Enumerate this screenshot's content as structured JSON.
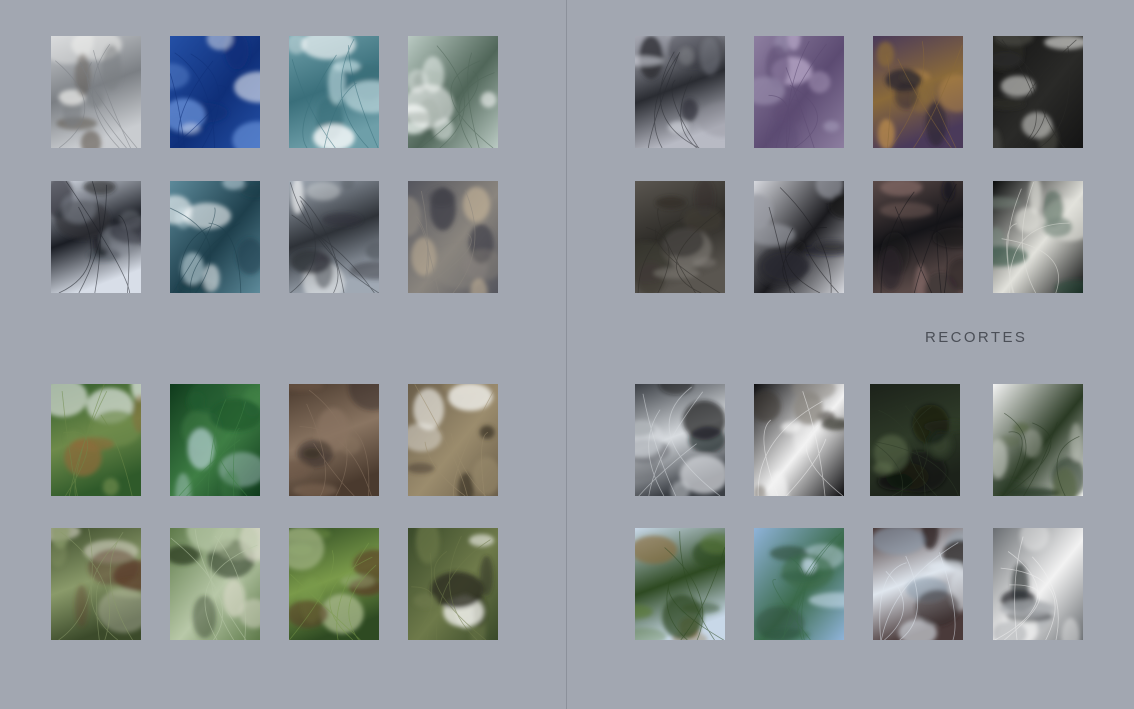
{
  "page": {
    "section_label": "RECORTES"
  },
  "photos": {
    "left": [
      {
        "subject": "steam-over-field",
        "colors": [
          "#c9ccd0",
          "#7b7f84",
          "#f2f2f0",
          "#5e564d"
        ]
      },
      {
        "subject": "deep-blue-water",
        "colors": [
          "#2450a6",
          "#0f2f79",
          "#6b95dc",
          "#ffffff"
        ]
      },
      {
        "subject": "turquoise-waves",
        "colors": [
          "#6e9fa9",
          "#3a6f7b",
          "#bcd7dc",
          "#ffffff"
        ]
      },
      {
        "subject": "wave-splash",
        "colors": [
          "#b9c9c2",
          "#506659",
          "#e9f0ec",
          "#ffffff"
        ]
      },
      {
        "subject": "bare-branches",
        "colors": [
          "#d8dee8",
          "#1a1d24",
          "#8a8f99",
          "#2f3138"
        ]
      },
      {
        "subject": "turbulent-water",
        "colors": [
          "#5d8a9a",
          "#1e3f4c",
          "#d9eaf1",
          "#ffffff"
        ]
      },
      {
        "subject": "cloud-mountain",
        "colors": [
          "#a0a9b4",
          "#2e3238",
          "#eceeef",
          "#5a5f66"
        ]
      },
      {
        "subject": "stormy-sky",
        "colors": [
          "#55565e",
          "#8a857e",
          "#c9b79b",
          "#3f4048"
        ]
      },
      {
        "subject": "mossy-cliff",
        "colors": [
          "#2f5a2a",
          "#6e8a4a",
          "#d7dfd8",
          "#8a6b3a"
        ]
      },
      {
        "subject": "leaves-backlit",
        "colors": [
          "#0f3a1c",
          "#3f7f45",
          "#c8dde8",
          "#1f5a2e"
        ]
      },
      {
        "subject": "twisted-vine",
        "colors": [
          "#4a3a2e",
          "#8a7562",
          "#2c2420",
          "#6e5a48"
        ]
      },
      {
        "subject": "tree-bark-snow",
        "colors": [
          "#6a5e4a",
          "#9b8c6d",
          "#f4f4f0",
          "#3e3628"
        ]
      },
      {
        "subject": "tree-trunk-forest",
        "colors": [
          "#3b4a2a",
          "#8a9a6a",
          "#5a3a28",
          "#c8c8b8"
        ]
      },
      {
        "subject": "palm-fronds",
        "colors": [
          "#5e7a4a",
          "#b8c8a8",
          "#2e3e24",
          "#d8d8c8"
        ]
      },
      {
        "subject": "forest-vine",
        "colors": [
          "#2e4a22",
          "#7a9a4a",
          "#5a3e26",
          "#a8b88a"
        ]
      },
      {
        "subject": "snowy-moss",
        "colors": [
          "#3a4a2a",
          "#6e7a4a",
          "#f2f2ee",
          "#2a2a1e"
        ]
      }
    ],
    "right": [
      {
        "subject": "branches-grey-sky",
        "colors": [
          "#b8bac4",
          "#2a2c32",
          "#8c8e98",
          "#cfd1d9"
        ]
      },
      {
        "subject": "purple-leaf",
        "colors": [
          "#8d7ea0",
          "#5c4b72",
          "#b9a9c9",
          "#9a8fae"
        ]
      },
      {
        "subject": "purple-crab",
        "colors": [
          "#4a3a5a",
          "#8a6a3a",
          "#2a2630",
          "#b88a4a"
        ]
      },
      {
        "subject": "dew-drops-dark",
        "colors": [
          "#141414",
          "#2a2a28",
          "#e8e8e4",
          "#4a4a44"
        ]
      },
      {
        "subject": "dry-grass-tangle",
        "colors": [
          "#5a5650",
          "#2e2c28",
          "#8a8680",
          "#3e3a34"
        ]
      },
      {
        "subject": "bare-tree-sky",
        "colors": [
          "#d6d8de",
          "#1a1a1e",
          "#9a9ca4",
          "#2a2a30"
        ]
      },
      {
        "subject": "dark-seed-leaves",
        "colors": [
          "#5a4a48",
          "#141418",
          "#8a6e6a",
          "#2a2428"
        ]
      },
      {
        "subject": "birch-trunks",
        "colors": [
          "#0a0c0c",
          "#e2e2dc",
          "#2a4a3a",
          "#7a8a80"
        ]
      },
      {
        "subject": "ice-on-branches",
        "colors": [
          "#3a3e44",
          "#d8dce0",
          "#18191c",
          "#6a6e74"
        ]
      },
      {
        "subject": "snow-on-branches",
        "colors": [
          "#0e0e10",
          "#f2f2f2",
          "#3a3832",
          "#8a8680"
        ]
      },
      {
        "subject": "dark-foliage",
        "colors": [
          "#1c221a",
          "#2e3a28",
          "#5a6a4a",
          "#0e120c"
        ]
      },
      {
        "subject": "snow-ivy",
        "colors": [
          "#f4f4f4",
          "#2a3a24",
          "#5a6a48",
          "#c8ccc4"
        ]
      },
      {
        "subject": "hanging-nest",
        "colors": [
          "#c8d8e8",
          "#2e4a22",
          "#8a6a3a",
          "#5a7a3a"
        ]
      },
      {
        "subject": "cactus-blue-sky",
        "colors": [
          "#8fb3d9",
          "#3a6a4a",
          "#c8dcec",
          "#2a4a3a"
        ]
      },
      {
        "subject": "ice-rock",
        "colors": [
          "#4a3a3a",
          "#dfe6ee",
          "#8a9aaa",
          "#2a2222"
        ]
      },
      {
        "subject": "misty-water",
        "colors": [
          "#6a6e72",
          "#f2f2f2",
          "#2a2e32",
          "#a8acb0"
        ]
      }
    ]
  }
}
